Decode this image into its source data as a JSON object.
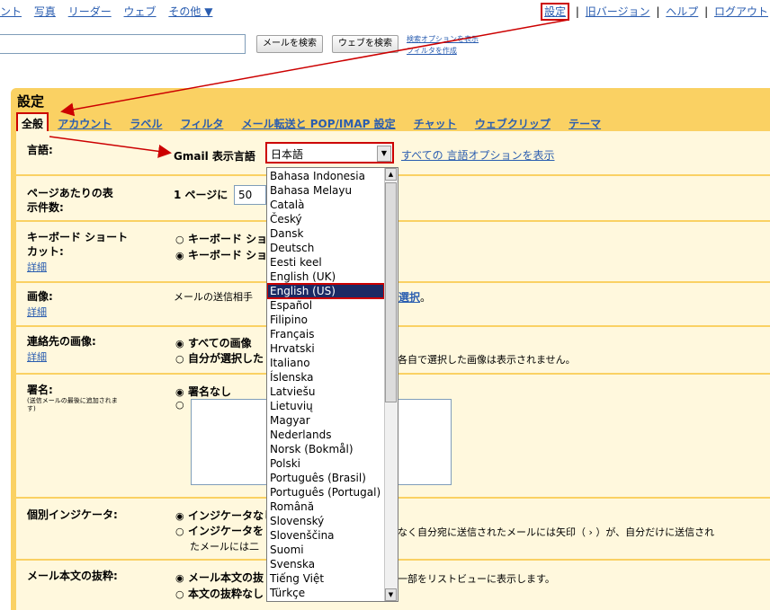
{
  "top_nav": {
    "left_links": [
      "ント",
      "写真",
      "リーダー",
      "ウェブ",
      "その他 ▼"
    ],
    "settings": "設定",
    "old_version": "旧バージョン",
    "help": "ヘルプ",
    "logout": "ログアウト",
    "separator": "|"
  },
  "search": {
    "mail_button": "メールを検索",
    "web_button": "ウェブを検索",
    "options_link": "検索オプションを表示",
    "filter_link": "フィルタを作成"
  },
  "settings": {
    "title": "設定",
    "tabs": [
      "全般",
      "アカウント",
      "ラベル",
      "フィルタ",
      "メール転送と POP/IMAP 設定",
      "チャット",
      "ウェブクリップ",
      "テーマ"
    ],
    "active_tab": "全般"
  },
  "sections": {
    "language": {
      "label": "言語:",
      "display_label": "Gmail 表示言語",
      "selected": "日本語",
      "all_options_link": "すべての 言語オプションを表示"
    },
    "page_size": {
      "label_line1": "ページあたりの表",
      "label_line2": "示件数:",
      "prefix": "1 ページに",
      "value": "50"
    },
    "shortcuts": {
      "label_line1": "キーボード ショート",
      "label_line2": "カット:",
      "detail": "詳細",
      "option1": "キーボード ショ",
      "option2": "キーボード ショ"
    },
    "picture": {
      "label": "画像:",
      "detail": "詳細",
      "text": "メールの送信相手",
      "select_link": "選択",
      "period": "。"
    },
    "contact_images": {
      "label": "連絡先の画像:",
      "detail": "詳細",
      "option1": "すべての画像",
      "option2": "自分が選択した",
      "trailing": "各自で選択した画像は表示されません。"
    },
    "signature": {
      "label": "署名:",
      "sublabel": "(送信メールの最後に追加されます)",
      "option_none": "署名なし"
    },
    "indicators": {
      "label": "個別インジケータ:",
      "option1": "インジケータなし",
      "option2": "インジケータを",
      "line2_text": "なく自分宛に送信されたメールには矢印（ › ）が、自分だけに送信され",
      "line3_text": "たメールには二"
    },
    "snippets": {
      "label": "メール本文の抜粋:",
      "option1": "メール本文の抜",
      "option2": "本文の抜粋なし",
      "trailing": "一部をリストビューに表示します。"
    }
  },
  "language_list": {
    "items": [
      "Bahasa Indonesia",
      "Bahasa Melayu",
      "Català",
      "Český",
      "Dansk",
      "Deutsch",
      "Eesti keel",
      "English (UK)",
      "English (US)",
      "Español",
      "Filipino",
      "Français",
      "Hrvatski",
      "Italiano",
      "Íslenska",
      "Latviešu",
      "Lietuvių",
      "Magyar",
      "Nederlands",
      "Norsk (Bokmål)",
      "Polski",
      "Português (Brasil)",
      "Português (Portugal)",
      "Română",
      "Slovenský",
      "Slovenščina",
      "Suomi",
      "Svenska",
      "Tiếng Việt",
      "Türkçe"
    ],
    "selected": "English (US)"
  },
  "colors": {
    "panel": "#fad163",
    "content": "#fff8dd",
    "link": "#2a5db0",
    "highlight": "#cc0000",
    "selection": "#1c2a64"
  }
}
